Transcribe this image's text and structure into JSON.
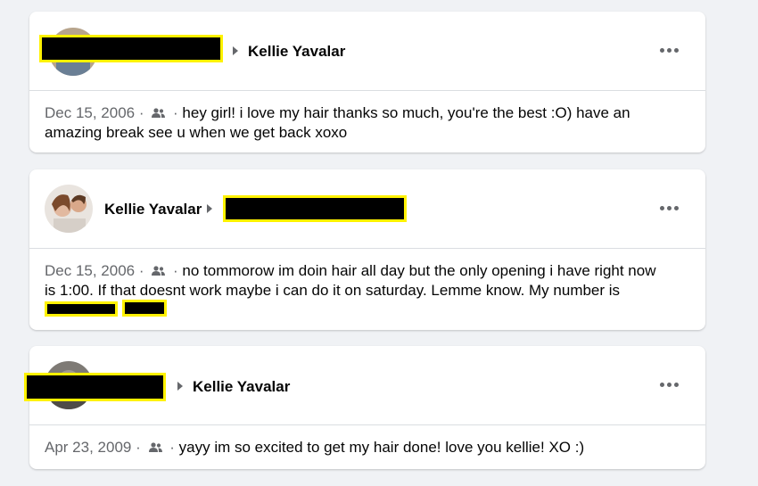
{
  "posts": [
    {
      "author_redacted": true,
      "recipient": "Kellie Yavalar",
      "date": "Dec 15, 2006",
      "separator": "·",
      "audience_icon": "friends-icon",
      "message": "hey girl! i love my hair thanks so much, you're the best :O) have an amazing break see u when we get back xoxo"
    },
    {
      "author": "Kellie Yavalar",
      "recipient_redacted": true,
      "date": "Dec 15, 2006",
      "separator": "·",
      "audience_icon": "friends-icon",
      "message": "no tommorow im doin hair all day but the only opening i have right now is 1:00. If that doesnt work maybe i can do it on saturday. Lemme know. My number is"
    },
    {
      "author_redacted": true,
      "recipient": "Kellie Yavalar",
      "date": "Apr 23, 2009",
      "separator": "·",
      "audience_icon": "friends-icon",
      "message": "yayy im so excited to get my hair done! love you kellie! XO :)"
    }
  ],
  "colors": {
    "background": "#f0f2f5",
    "card": "#ffffff",
    "muted_text": "#65676b",
    "redaction_fill": "#000000",
    "redaction_border": "#fff200"
  }
}
